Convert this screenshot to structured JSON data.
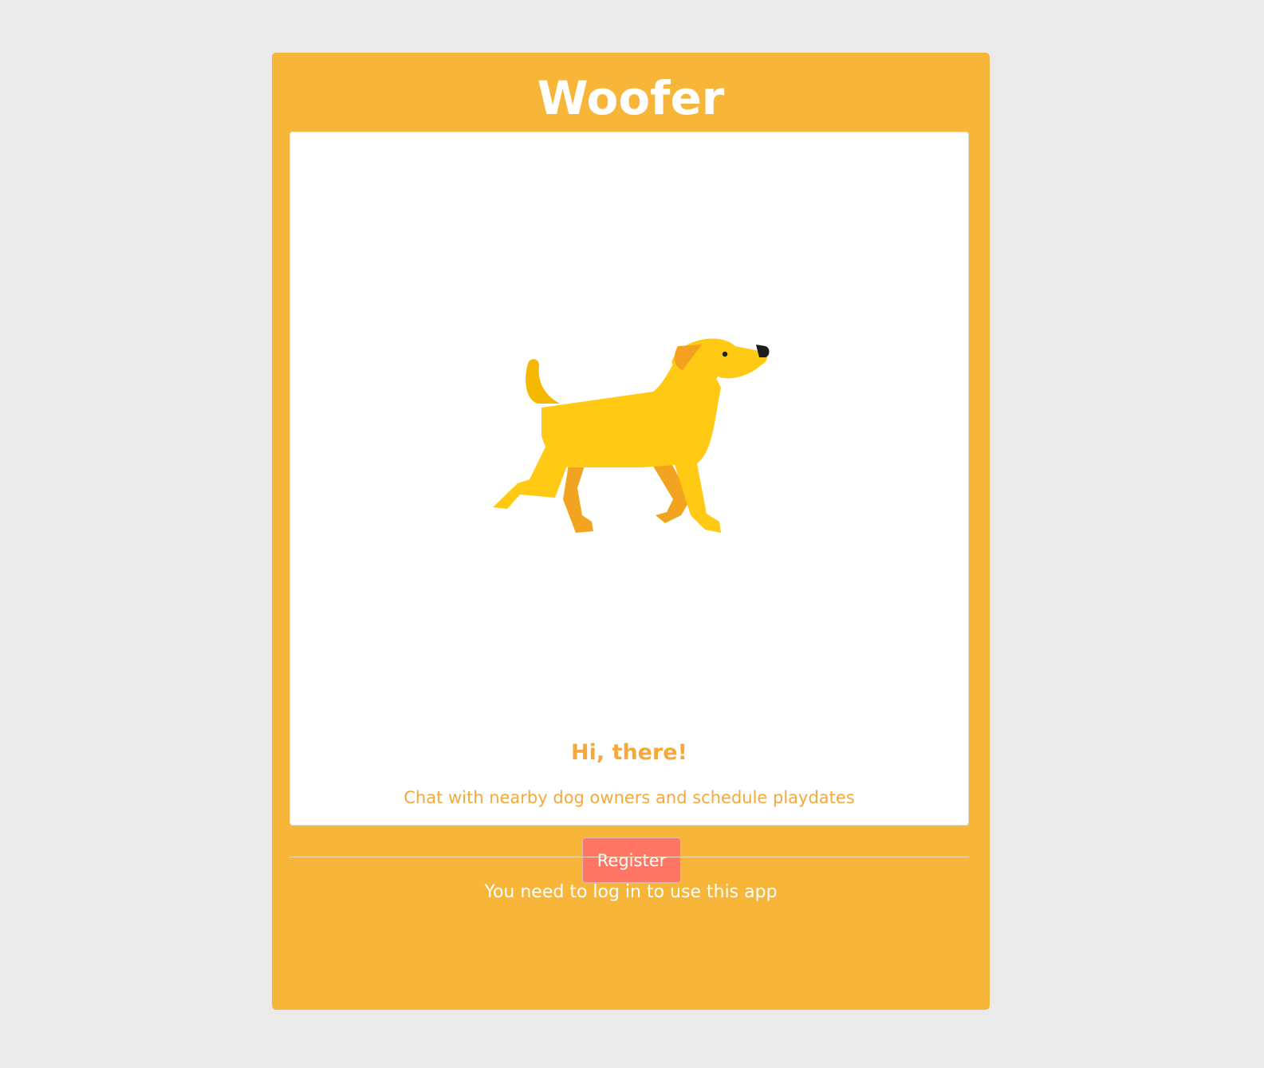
{
  "app": {
    "title": "Woofer",
    "accent_color": "#f7b53a",
    "background_color": "#eaeaea"
  },
  "hero": {
    "image": "dog-illustration",
    "greeting": "Hi, there!",
    "tagline": "Chat with nearby dog owners and schedule playdates",
    "register_label": "Register",
    "register_color": "#ff7665"
  },
  "footer": {
    "login_note": "You need to log in to use this app"
  }
}
